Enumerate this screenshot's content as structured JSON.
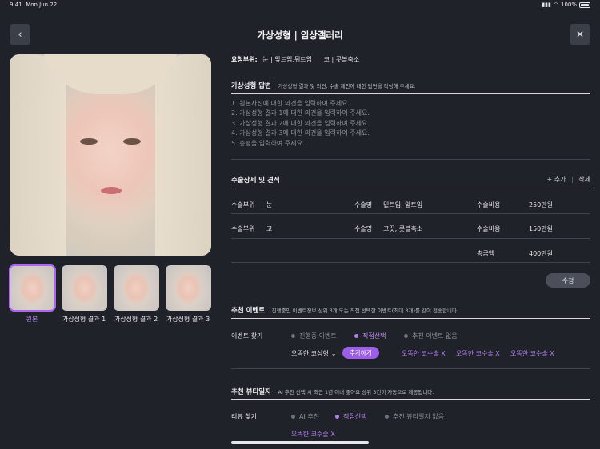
{
  "status": {
    "time": "9:41",
    "date": "Mon Jun 22",
    "battery": "100%"
  },
  "header": {
    "title": "가상성형 | 임상갤러리",
    "back_icon": "‹",
    "close_icon": "✕"
  },
  "gallery": {
    "thumbnails": [
      {
        "label": "원본",
        "active": true
      },
      {
        "label": "가상성형 결과 1",
        "active": false
      },
      {
        "label": "가상성형 결과 2",
        "active": false
      },
      {
        "label": "가상성형 결과 3",
        "active": false
      }
    ]
  },
  "request": {
    "label": "요청부위:",
    "value1": "눈 | 앞트임,뒤트임",
    "value2": "코 | 콧볼축소"
  },
  "answer": {
    "title": "가상성형 답변",
    "subtitle": "가상성형 결과 및 의견, 수술 제안에 대한 답변을 작성해 주세요.",
    "lines": [
      "1. 원본사진에 대한 의견을 입력하여 주세요.",
      "2. 가상성형 결과 1에 대한 의견을 입력하여 주세요.",
      "3. 가상성형 결과 2에 대한 의견을 입력하여 주세요.",
      "4. 가상성형 결과 3에 대한 의견을 입력하여 주세요.",
      "5. 총평을 입력하여 주세요."
    ]
  },
  "surgery": {
    "title": "수술상세 및 견적",
    "add_label": "+ 추가",
    "separator": "|",
    "delete_label": "삭제",
    "rows": [
      {
        "part_label": "수술부위",
        "part": "눈",
        "name_label": "수술명",
        "name": "밑트임, 앞트임",
        "cost_label": "수술비용",
        "cost": "250만원"
      },
      {
        "part_label": "수술부위",
        "part": "코",
        "name_label": "수술명",
        "name": "코끗, 콧볼축소",
        "cost_label": "수술비용",
        "cost": "150만원"
      }
    ],
    "total_label": "총금액",
    "total": "400만원",
    "edit_label": "수정"
  },
  "events": {
    "title": "추천 이벤트",
    "subtitle": "진행중인 이벤트정보 상위 3개 또는 직접 선택한 이벤트(최대 3개)를 같이 전송합니다.",
    "find_label": "이벤트 찾기",
    "options": [
      {
        "label": "진행중 이벤트",
        "selected": false
      },
      {
        "label": "직접선택",
        "selected": true
      },
      {
        "label": "추천 이벤트 없음",
        "selected": false
      }
    ],
    "select_value": "오똑한 코성형",
    "add_button": "추가하기",
    "chips": [
      "오똑한 코수술 X",
      "오똑한 코수술 X",
      "오똑한 코수술 X"
    ]
  },
  "diary": {
    "title": "추천 뷰티일지",
    "subtitle": "AI 추천 선택 시 최근 1년 이내 좋아요 상위 3건이 자동으로 제공됩니다.",
    "find_label": "리뷰 찾기",
    "options": [
      {
        "label": "AI 추천",
        "selected": false
      },
      {
        "label": "직접선택",
        "selected": true
      },
      {
        "label": "추천 뷰티일지 없음",
        "selected": false
      }
    ],
    "chips": [
      "오똑한 코수술 X"
    ]
  }
}
